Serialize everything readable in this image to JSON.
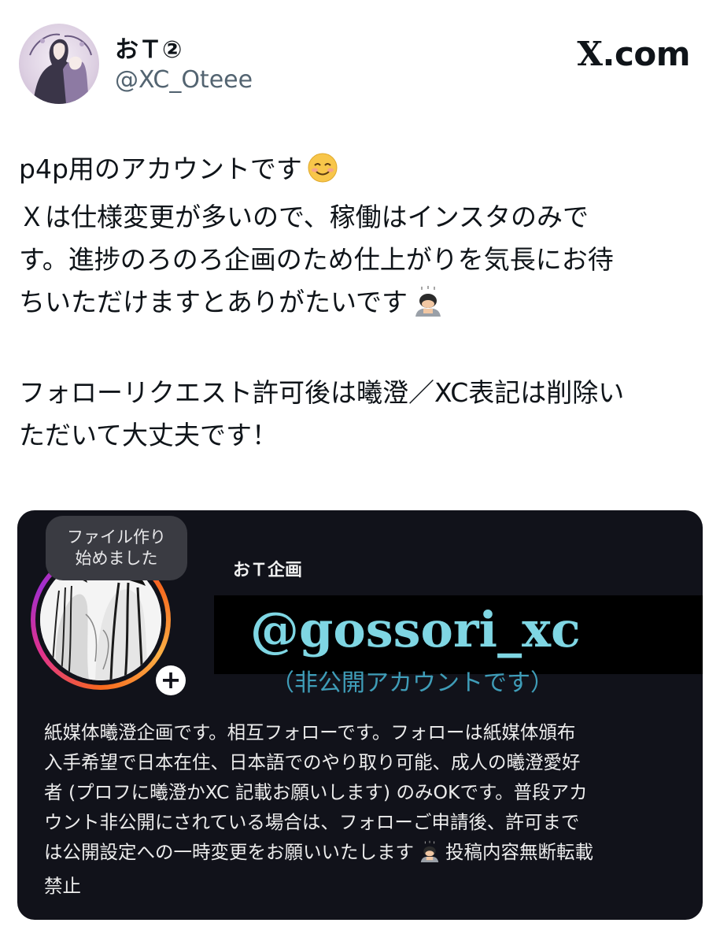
{
  "header": {
    "display_name": "おＴ②",
    "handle": "@XC_Oteee",
    "brand_mark": "X",
    "brand_suffix": ".com"
  },
  "tweet": {
    "lines": [
      "p4p用のアカウントです",
      "Ｘは仕様変更が多いので、稼働はインスタのみで",
      "す。進捗のろのろ企画のため仕上がりを気長にお待",
      "ちいただけますとありがたいです",
      "",
      "フォローリクエスト許可後は曦澄／XC表記は削除い",
      "ただいて大丈夫です！"
    ],
    "emojis": [
      "smiling-face-emoji",
      "bowing-person-emoji"
    ]
  },
  "media": {
    "note_bubble": [
      "ファイル作り",
      "始めました"
    ],
    "account_name": "おＴ企画",
    "big_handle": "@gossori_xc",
    "private_note": "（非公開アカウントです）",
    "bio_lines": [
      "紙媒体曦澄企画です。相互フォローです。フォローは紙媒体頒布",
      "入手希望で日本在住、日本語でのやり取り可能、成人の曦澄愛好",
      "者 (プロフに曦澄かXC 記載お願いします) のみOKです。普段アカ",
      "ウント非公開にされている場合は、フォローご申請後、許可まで",
      "は公開設定への一時変更をお願いいたします",
      "禁止"
    ],
    "bio_line5_suffix": "投稿内容無断転載",
    "plus_label": "+"
  },
  "colors": {
    "text_primary": "#0f1419",
    "text_secondary": "#536471",
    "card_bg": "#11121a",
    "handle_cyan": "#7fd6e3",
    "note_blue": "#3f9db8"
  }
}
